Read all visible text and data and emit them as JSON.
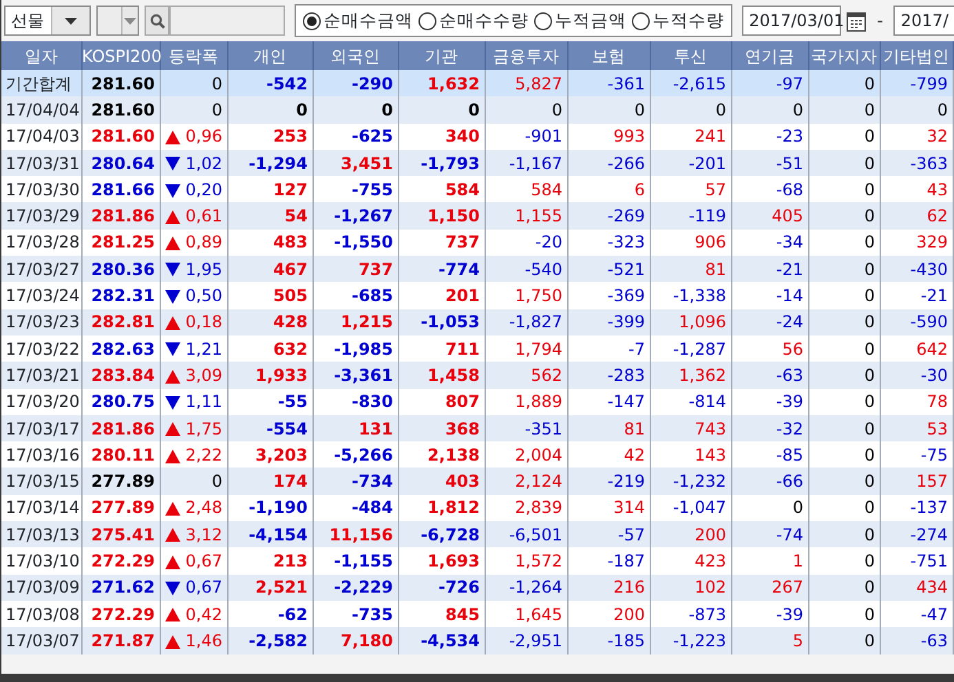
{
  "toolbar": {
    "market_select": {
      "value": "선물"
    },
    "sub_select": {
      "disabled": true
    },
    "radios": [
      {
        "label": "순매수금액",
        "selected": true
      },
      {
        "label": "순매수수량",
        "selected": false
      },
      {
        "label": "누적금액",
        "selected": false
      },
      {
        "label": "누적수량",
        "selected": false
      }
    ],
    "date_from": "2017/03/01",
    "date_separator": "-",
    "date_to": "2017/"
  },
  "table": {
    "columns": [
      "일자",
      "KOSPI200",
      "등락폭",
      "개인",
      "외국인",
      "기관",
      "금융투자",
      "보험",
      "투신",
      "연기금",
      "국가지자",
      "기타법인"
    ],
    "rows": [
      {
        "kind": "summary",
        "date": "기간합계",
        "kospi": "281.60",
        "up": false,
        "down": false,
        "change": "0",
        "values": [
          "-542",
          "-290",
          "1,632",
          "5,827",
          "-361",
          "-2,615",
          "-97",
          "0",
          "-799"
        ]
      },
      {
        "kind": "day",
        "date": "17/04/04",
        "kospi": "281.60",
        "up": false,
        "down": false,
        "change": "0",
        "values": [
          "0",
          "0",
          "0",
          "0",
          "0",
          "0",
          "0",
          "0",
          "0"
        ]
      },
      {
        "kind": "day",
        "date": "17/04/03",
        "kospi": "281.60",
        "up": true,
        "down": false,
        "change": "0,96",
        "values": [
          "253",
          "-625",
          "340",
          "-901",
          "993",
          "241",
          "-23",
          "0",
          "32"
        ]
      },
      {
        "kind": "day",
        "date": "17/03/31",
        "kospi": "280.64",
        "up": false,
        "down": true,
        "change": "1,02",
        "values": [
          "-1,294",
          "3,451",
          "-1,793",
          "-1,167",
          "-266",
          "-201",
          "-51",
          "0",
          "-363"
        ]
      },
      {
        "kind": "day",
        "date": "17/03/30",
        "kospi": "281.66",
        "up": false,
        "down": true,
        "change": "0,20",
        "values": [
          "127",
          "-755",
          "584",
          "584",
          "6",
          "57",
          "-68",
          "0",
          "43"
        ]
      },
      {
        "kind": "day",
        "date": "17/03/29",
        "kospi": "281.86",
        "up": true,
        "down": false,
        "change": "0,61",
        "values": [
          "54",
          "-1,267",
          "1,150",
          "1,155",
          "-269",
          "-119",
          "405",
          "0",
          "62"
        ]
      },
      {
        "kind": "day",
        "date": "17/03/28",
        "kospi": "281.25",
        "up": true,
        "down": false,
        "change": "0,89",
        "values": [
          "483",
          "-1,550",
          "737",
          "-20",
          "-323",
          "906",
          "-34",
          "0",
          "329"
        ]
      },
      {
        "kind": "day",
        "date": "17/03/27",
        "kospi": "280.36",
        "up": false,
        "down": true,
        "change": "1,95",
        "values": [
          "467",
          "737",
          "-774",
          "-540",
          "-521",
          "81",
          "-21",
          "0",
          "-430"
        ]
      },
      {
        "kind": "day",
        "date": "17/03/24",
        "kospi": "282.31",
        "up": false,
        "down": true,
        "change": "0,50",
        "values": [
          "505",
          "-685",
          "201",
          "1,750",
          "-369",
          "-1,338",
          "-14",
          "0",
          "-21"
        ]
      },
      {
        "kind": "day",
        "date": "17/03/23",
        "kospi": "282.81",
        "up": true,
        "down": false,
        "change": "0,18",
        "values": [
          "428",
          "1,215",
          "-1,053",
          "-1,827",
          "-399",
          "1,096",
          "-24",
          "0",
          "-590"
        ]
      },
      {
        "kind": "day",
        "date": "17/03/22",
        "kospi": "282.63",
        "up": false,
        "down": true,
        "change": "1,21",
        "values": [
          "632",
          "-1,985",
          "711",
          "1,794",
          "-7",
          "-1,287",
          "56",
          "0",
          "642"
        ]
      },
      {
        "kind": "day",
        "date": "17/03/21",
        "kospi": "283.84",
        "up": true,
        "down": false,
        "change": "3,09",
        "values": [
          "1,933",
          "-3,361",
          "1,458",
          "562",
          "-283",
          "1,362",
          "-63",
          "0",
          "-30"
        ]
      },
      {
        "kind": "day",
        "date": "17/03/20",
        "kospi": "280.75",
        "up": false,
        "down": true,
        "change": "1,11",
        "values": [
          "-55",
          "-830",
          "807",
          "1,889",
          "-147",
          "-814",
          "-39",
          "0",
          "78"
        ]
      },
      {
        "kind": "day",
        "date": "17/03/17",
        "kospi": "281.86",
        "up": true,
        "down": false,
        "change": "1,75",
        "values": [
          "-554",
          "131",
          "368",
          "-351",
          "81",
          "743",
          "-32",
          "0",
          "53"
        ]
      },
      {
        "kind": "day",
        "date": "17/03/16",
        "kospi": "280.11",
        "up": true,
        "down": false,
        "change": "2,22",
        "values": [
          "3,203",
          "-5,266",
          "2,138",
          "2,004",
          "42",
          "143",
          "-85",
          "0",
          "-75"
        ]
      },
      {
        "kind": "day",
        "date": "17/03/15",
        "kospi": "277.89",
        "up": false,
        "down": false,
        "change": "0",
        "values": [
          "174",
          "-734",
          "403",
          "2,124",
          "-219",
          "-1,232",
          "-66",
          "0",
          "157"
        ]
      },
      {
        "kind": "day",
        "date": "17/03/14",
        "kospi": "277.89",
        "up": true,
        "down": false,
        "change": "2,48",
        "values": [
          "-1,190",
          "-484",
          "1,812",
          "2,839",
          "314",
          "-1,047",
          "0",
          "0",
          "-137"
        ]
      },
      {
        "kind": "day",
        "date": "17/03/13",
        "kospi": "275.41",
        "up": true,
        "down": false,
        "change": "3,12",
        "values": [
          "-4,154",
          "11,156",
          "-6,728",
          "-6,501",
          "-57",
          "200",
          "-74",
          "0",
          "-274"
        ]
      },
      {
        "kind": "day",
        "date": "17/03/10",
        "kospi": "272.29",
        "up": true,
        "down": false,
        "change": "0,67",
        "values": [
          "213",
          "-1,155",
          "1,693",
          "1,572",
          "-187",
          "423",
          "1",
          "0",
          "-751"
        ]
      },
      {
        "kind": "day",
        "date": "17/03/09",
        "kospi": "271.62",
        "up": false,
        "down": true,
        "change": "0,67",
        "values": [
          "2,521",
          "-2,229",
          "-726",
          "-1,264",
          "216",
          "102",
          "267",
          "0",
          "434"
        ]
      },
      {
        "kind": "day",
        "date": "17/03/08",
        "kospi": "272.29",
        "up": true,
        "down": false,
        "change": "0,42",
        "values": [
          "-62",
          "-735",
          "845",
          "1,645",
          "200",
          "-873",
          "-39",
          "0",
          "-47"
        ]
      },
      {
        "kind": "day",
        "date": "17/03/07",
        "kospi": "271.87",
        "up": true,
        "down": false,
        "change": "1,46",
        "values": [
          "-2,582",
          "7,180",
          "-4,534",
          "-2,951",
          "-185",
          "-1,223",
          "5",
          "0",
          "-63"
        ]
      }
    ]
  }
}
